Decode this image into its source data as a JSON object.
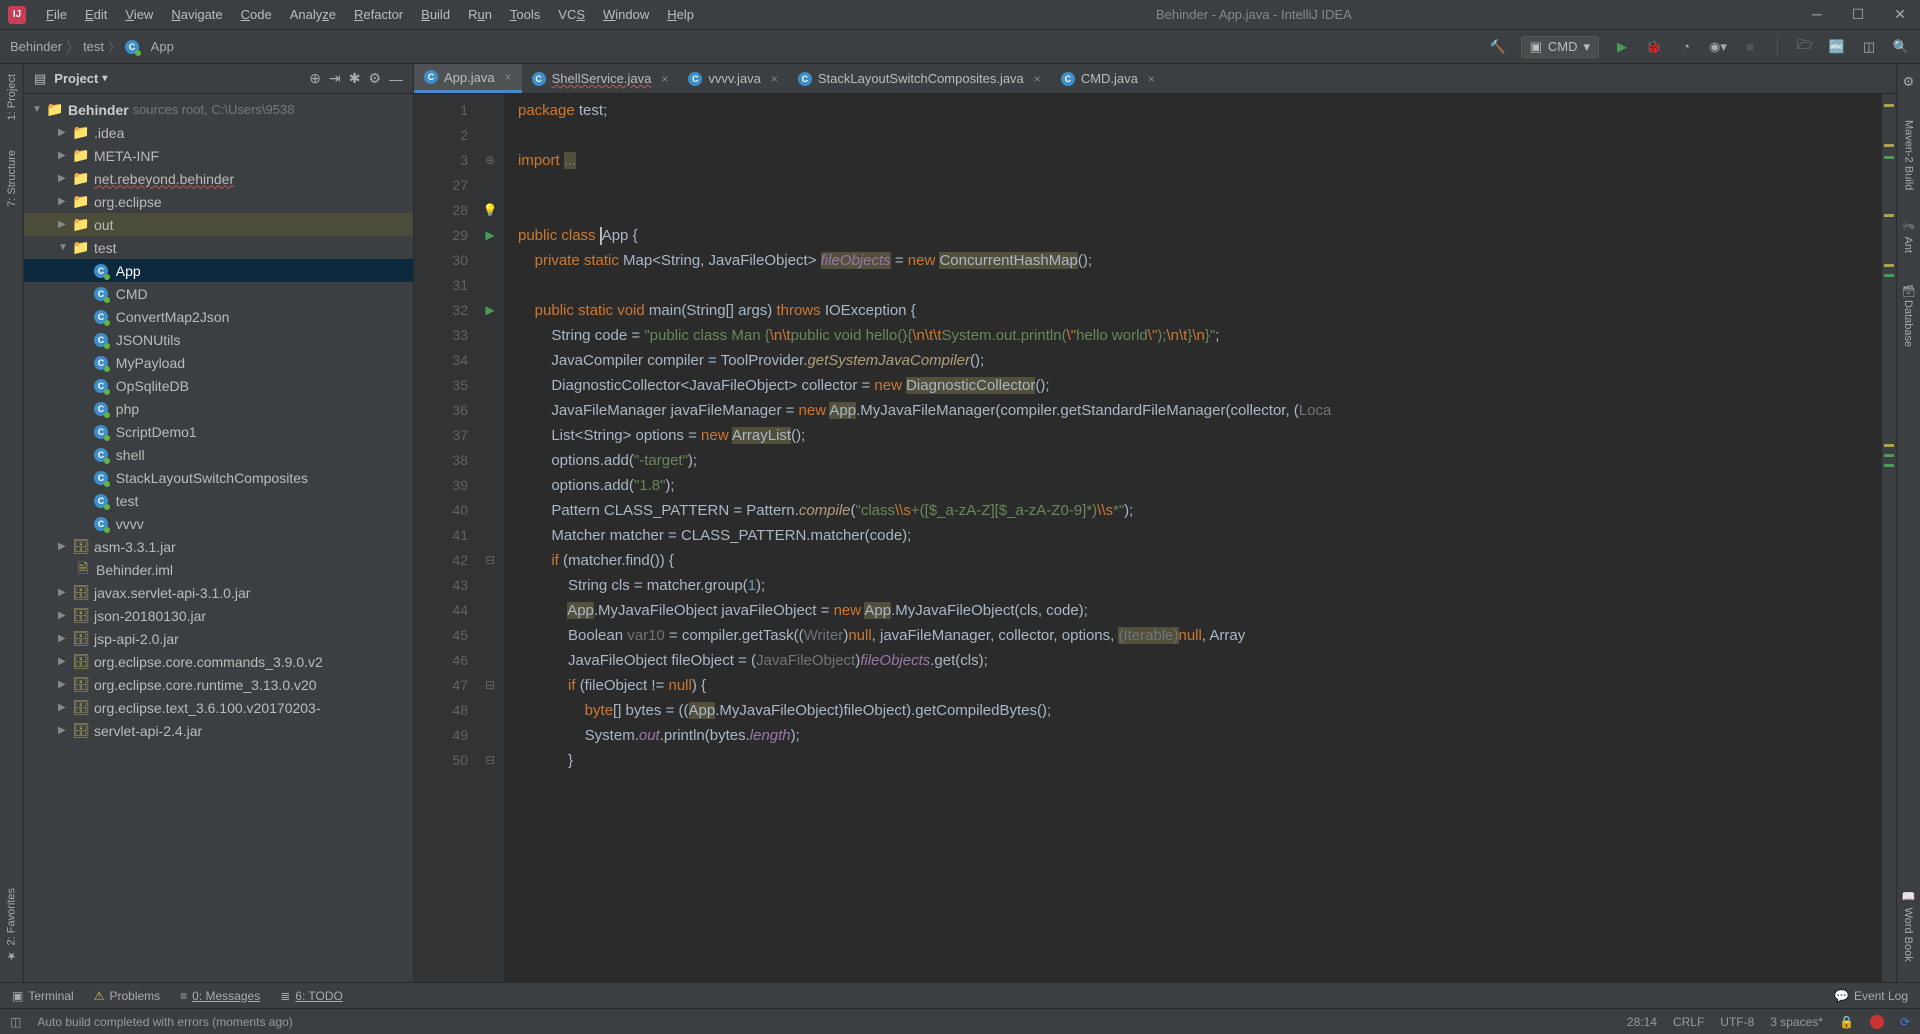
{
  "window": {
    "title": "Behinder - App.java - IntelliJ IDEA"
  },
  "menu": [
    "File",
    "Edit",
    "View",
    "Navigate",
    "Code",
    "Analyze",
    "Refactor",
    "Build",
    "Run",
    "Tools",
    "VCS",
    "Window",
    "Help"
  ],
  "breadcrumbs": {
    "part1": "Behinder",
    "part2": "test",
    "part3": "App"
  },
  "run_config": {
    "label": "CMD"
  },
  "project_header": {
    "title": "Project"
  },
  "tree": {
    "root": "Behinder",
    "root_hint": "sources root, C:\\Users\\9538",
    "idea": ".idea",
    "metainf": "META-INF",
    "rebeyond": "net.rebeyond.behinder",
    "orgeclipse": "org.eclipse",
    "out": "out",
    "test": "test",
    "files": {
      "App": "App",
      "CMD": "CMD",
      "ConvertMap2Json": "ConvertMap2Json",
      "JSONUtils": "JSONUtils",
      "MyPayload": "MyPayload",
      "OpSqliteDB": "OpSqliteDB",
      "php": "php",
      "ScriptDemo1": "ScriptDemo1",
      "shell": "shell",
      "StackLayoutSwitchComposites": "StackLayoutSwitchComposites",
      "testf": "test",
      "vvvv": "vvvv"
    },
    "jars": {
      "asm": "asm-3.3.1.jar",
      "iml": "Behinder.iml",
      "servlet": "javax.servlet-api-3.1.0.jar",
      "json": "json-20180130.jar",
      "jsp": "jsp-api-2.0.jar",
      "commands": "org.eclipse.core.commands_3.9.0.v2",
      "runtime": "org.eclipse.core.runtime_3.13.0.v20",
      "text": "org.eclipse.text_3.6.100.v20170203-",
      "servlet24": "servlet-api-2.4.jar"
    }
  },
  "tabs": [
    {
      "label": "App.java",
      "active": true
    },
    {
      "label": "ShellService.java",
      "active": false,
      "squiggle": true
    },
    {
      "label": "vvvv.java",
      "active": false
    },
    {
      "label": "StackLayoutSwitchComposites.java",
      "active": false
    },
    {
      "label": "CMD.java",
      "active": false
    }
  ],
  "gutter_lines": [
    "1",
    "2",
    "3",
    "27",
    "",
    "28",
    "29",
    "30",
    "31",
    "32",
    "33",
    "34",
    "35",
    "36",
    "37",
    "38",
    "39",
    "40",
    "41",
    "42",
    "43",
    "44",
    "45",
    "46",
    "47",
    "48",
    "49",
    "50"
  ],
  "code": {
    "l1a": "package ",
    "l1b": "test;",
    "l3a": "import ",
    "l3b": "...",
    "l28a": "public class ",
    "l28b": "App ",
    "l28c": "{",
    "l29a": "    private static ",
    "l29b": "Map<String, JavaFileObject> ",
    "l29c": "fileObjects",
    "l29d": " = ",
    "l29e": "new ",
    "l29f": "ConcurrentHashMap",
    "l29g": "();",
    "l31a": "    public static void ",
    "l31b": "main",
    "l31c": "(String[] args) ",
    "l31d": "throws ",
    "l31e": "IOException ",
    "l31f": "{",
    "l32a": "        String code = ",
    "l32b": "\"public class Man {",
    "l32c": "\\n\\t",
    "l32d": "public void hello(){",
    "l32e": "\\n\\t\\t",
    "l32f": "System.out.println(",
    "l32g": "\\\"",
    "l32h": "hello world",
    "l32i": "\\\"",
    "l32j": ");",
    "l32k": "\\n\\t",
    "l32l": "}",
    "l32m": "\\n",
    "l32n": "}\"",
    "l32o": ";",
    "l33a": "        JavaCompiler compiler = ToolProvider.",
    "l33b": "getSystemJavaCompiler",
    "l33c": "();",
    "l34a": "        DiagnosticCollector<JavaFileObject> collector = ",
    "l34b": "new ",
    "l34c": "DiagnosticCollector",
    "l34d": "();",
    "l35a": "        JavaFileManager javaFileManager = ",
    "l35b": "new ",
    "l35c": "App",
    "l35d": ".MyJavaFileManager(compiler.getStandardFileManager(collector, (",
    "l35e": "Loca",
    "l36a": "        List<String> options = ",
    "l36b": "new ",
    "l36c": "ArrayList",
    "l36d": "();",
    "l37a": "        options.add(",
    "l37b": "\"-target\"",
    "l37c": ");",
    "l38a": "        options.add(",
    "l38b": "\"1.8\"",
    "l38c": ");",
    "l39a": "        Pattern CLASS_PATTERN = Pattern.",
    "l39b": "compile",
    "l39c": "(",
    "l39d": "\"class",
    "l39e": "\\\\s",
    "l39f": "+([$_a-zA-Z][$_a-zA-Z0-9]*)",
    "l39g": "\\\\s",
    "l39h": "*\"",
    "l39i": ");",
    "l40a": "        Matcher matcher = CLASS_PATTERN.matcher(code);",
    "l41a": "        if ",
    "l41b": "(matcher.find()) {",
    "l42a": "            String cls = matcher.group(",
    "l42b": "1",
    "l42c": ");",
    "l43a": "            ",
    "l43b": "App",
    "l43c": ".MyJavaFileObject javaFileObject = ",
    "l43d": "new ",
    "l43e": "App",
    "l43f": ".MyJavaFileObject(cls, code);",
    "l44a": "            Boolean ",
    "l44b": "var10",
    "l44c": " = compiler.getTask((",
    "l44d": "Writer",
    "l44e": ")",
    "l44f": "null",
    "l44g": ", javaFileManager, collector, options, ",
    "l44h": "(Iterable)",
    "l44i": "null",
    "l44j": ", Array",
    "l45a": "            JavaFileObject fileObject = (",
    "l45b": "JavaFileObject",
    "l45c": ")",
    "l45d": "fileObjects",
    "l45e": ".get(cls);",
    "l46a": "            if ",
    "l46b": "(fileObject != ",
    "l46c": "null",
    "l46d": ") {",
    "l47a": "                byte",
    "l47b": "[] bytes = ((",
    "l47c": "App",
    "l47d": ".MyJavaFileObject)fileObject).getCompiledBytes();",
    "l48a": "                System.",
    "l48b": "out",
    "l48c": ".println(bytes.",
    "l48d": "length",
    "l48e": ");",
    "l49a": "            }"
  },
  "left_tools": {
    "project": "1: Project",
    "structure": "7: Structure",
    "favorites": "2: Favorites"
  },
  "right_tools": {
    "maven": "Maven-2 Build",
    "ant": "Ant",
    "database": "Database",
    "wordbook": "Word Book"
  },
  "bottom_tools": {
    "terminal": "Terminal",
    "problems": "Problems",
    "messages": "0: Messages",
    "todo": "6: TODO",
    "eventlog": "Event Log"
  },
  "status": {
    "msg": "Auto build completed with errors (moments ago)",
    "pos": "28:14",
    "lineend": "CRLF",
    "enc": "UTF-8",
    "indent": "3 spaces*"
  }
}
